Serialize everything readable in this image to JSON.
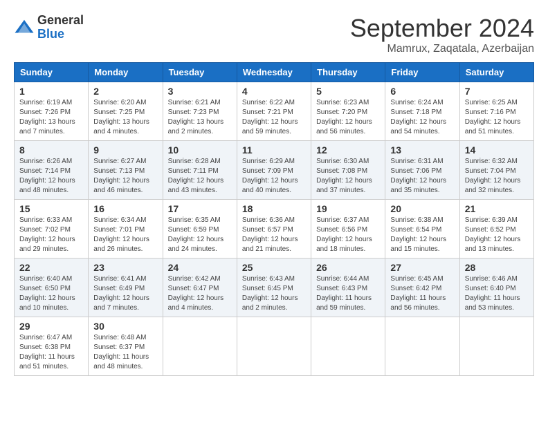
{
  "header": {
    "logo_general": "General",
    "logo_blue": "Blue",
    "month_title": "September 2024",
    "location": "Mamrux, Zaqatala, Azerbaijan"
  },
  "weekdays": [
    "Sunday",
    "Monday",
    "Tuesday",
    "Wednesday",
    "Thursday",
    "Friday",
    "Saturday"
  ],
  "rows": [
    {
      "shade": "white",
      "days": [
        {
          "num": "1",
          "sunrise": "6:19 AM",
          "sunset": "7:26 PM",
          "daylight": "13 hours and 7 minutes."
        },
        {
          "num": "2",
          "sunrise": "6:20 AM",
          "sunset": "7:25 PM",
          "daylight": "13 hours and 4 minutes."
        },
        {
          "num": "3",
          "sunrise": "6:21 AM",
          "sunset": "7:23 PM",
          "daylight": "13 hours and 2 minutes."
        },
        {
          "num": "4",
          "sunrise": "6:22 AM",
          "sunset": "7:21 PM",
          "daylight": "12 hours and 59 minutes."
        },
        {
          "num": "5",
          "sunrise": "6:23 AM",
          "sunset": "7:20 PM",
          "daylight": "12 hours and 56 minutes."
        },
        {
          "num": "6",
          "sunrise": "6:24 AM",
          "sunset": "7:18 PM",
          "daylight": "12 hours and 54 minutes."
        },
        {
          "num": "7",
          "sunrise": "6:25 AM",
          "sunset": "7:16 PM",
          "daylight": "12 hours and 51 minutes."
        }
      ]
    },
    {
      "shade": "shaded",
      "days": [
        {
          "num": "8",
          "sunrise": "6:26 AM",
          "sunset": "7:14 PM",
          "daylight": "12 hours and 48 minutes."
        },
        {
          "num": "9",
          "sunrise": "6:27 AM",
          "sunset": "7:13 PM",
          "daylight": "12 hours and 46 minutes."
        },
        {
          "num": "10",
          "sunrise": "6:28 AM",
          "sunset": "7:11 PM",
          "daylight": "12 hours and 43 minutes."
        },
        {
          "num": "11",
          "sunrise": "6:29 AM",
          "sunset": "7:09 PM",
          "daylight": "12 hours and 40 minutes."
        },
        {
          "num": "12",
          "sunrise": "6:30 AM",
          "sunset": "7:08 PM",
          "daylight": "12 hours and 37 minutes."
        },
        {
          "num": "13",
          "sunrise": "6:31 AM",
          "sunset": "7:06 PM",
          "daylight": "12 hours and 35 minutes."
        },
        {
          "num": "14",
          "sunrise": "6:32 AM",
          "sunset": "7:04 PM",
          "daylight": "12 hours and 32 minutes."
        }
      ]
    },
    {
      "shade": "white",
      "days": [
        {
          "num": "15",
          "sunrise": "6:33 AM",
          "sunset": "7:02 PM",
          "daylight": "12 hours and 29 minutes."
        },
        {
          "num": "16",
          "sunrise": "6:34 AM",
          "sunset": "7:01 PM",
          "daylight": "12 hours and 26 minutes."
        },
        {
          "num": "17",
          "sunrise": "6:35 AM",
          "sunset": "6:59 PM",
          "daylight": "12 hours and 24 minutes."
        },
        {
          "num": "18",
          "sunrise": "6:36 AM",
          "sunset": "6:57 PM",
          "daylight": "12 hours and 21 minutes."
        },
        {
          "num": "19",
          "sunrise": "6:37 AM",
          "sunset": "6:56 PM",
          "daylight": "12 hours and 18 minutes."
        },
        {
          "num": "20",
          "sunrise": "6:38 AM",
          "sunset": "6:54 PM",
          "daylight": "12 hours and 15 minutes."
        },
        {
          "num": "21",
          "sunrise": "6:39 AM",
          "sunset": "6:52 PM",
          "daylight": "12 hours and 13 minutes."
        }
      ]
    },
    {
      "shade": "shaded",
      "days": [
        {
          "num": "22",
          "sunrise": "6:40 AM",
          "sunset": "6:50 PM",
          "daylight": "12 hours and 10 minutes."
        },
        {
          "num": "23",
          "sunrise": "6:41 AM",
          "sunset": "6:49 PM",
          "daylight": "12 hours and 7 minutes."
        },
        {
          "num": "24",
          "sunrise": "6:42 AM",
          "sunset": "6:47 PM",
          "daylight": "12 hours and 4 minutes."
        },
        {
          "num": "25",
          "sunrise": "6:43 AM",
          "sunset": "6:45 PM",
          "daylight": "12 hours and 2 minutes."
        },
        {
          "num": "26",
          "sunrise": "6:44 AM",
          "sunset": "6:43 PM",
          "daylight": "11 hours and 59 minutes."
        },
        {
          "num": "27",
          "sunrise": "6:45 AM",
          "sunset": "6:42 PM",
          "daylight": "11 hours and 56 minutes."
        },
        {
          "num": "28",
          "sunrise": "6:46 AM",
          "sunset": "6:40 PM",
          "daylight": "11 hours and 53 minutes."
        }
      ]
    },
    {
      "shade": "white",
      "days": [
        {
          "num": "29",
          "sunrise": "6:47 AM",
          "sunset": "6:38 PM",
          "daylight": "11 hours and 51 minutes."
        },
        {
          "num": "30",
          "sunrise": "6:48 AM",
          "sunset": "6:37 PM",
          "daylight": "11 hours and 48 minutes."
        },
        null,
        null,
        null,
        null,
        null
      ]
    }
  ]
}
